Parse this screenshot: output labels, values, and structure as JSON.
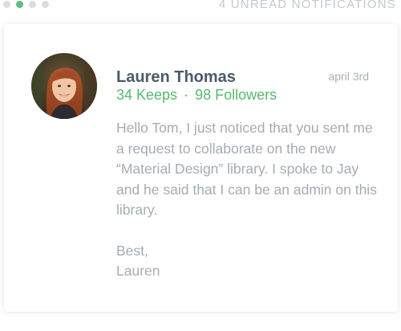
{
  "pager": {
    "dots": 4,
    "active_index": 1
  },
  "header": {
    "unread_label": "4 UNREAD NOTIFICATIONS"
  },
  "notification": {
    "author": "Lauren Thomas",
    "date": "april 3rd",
    "keeps": "34 Keeps",
    "separator": "·",
    "followers": "98 Followers",
    "message": "Hello Tom, I just noticed that you sent me a request to collaborate on the new “Material Design” library. I spoke to Jay and he said that I can be an admin on this library.",
    "closing": "Best,",
    "signature": "Lauren"
  },
  "colors": {
    "accent": "#56b96f",
    "name": "#4a5b6a",
    "muted": "#a5acb3",
    "dot_inactive": "#d9dde2"
  }
}
